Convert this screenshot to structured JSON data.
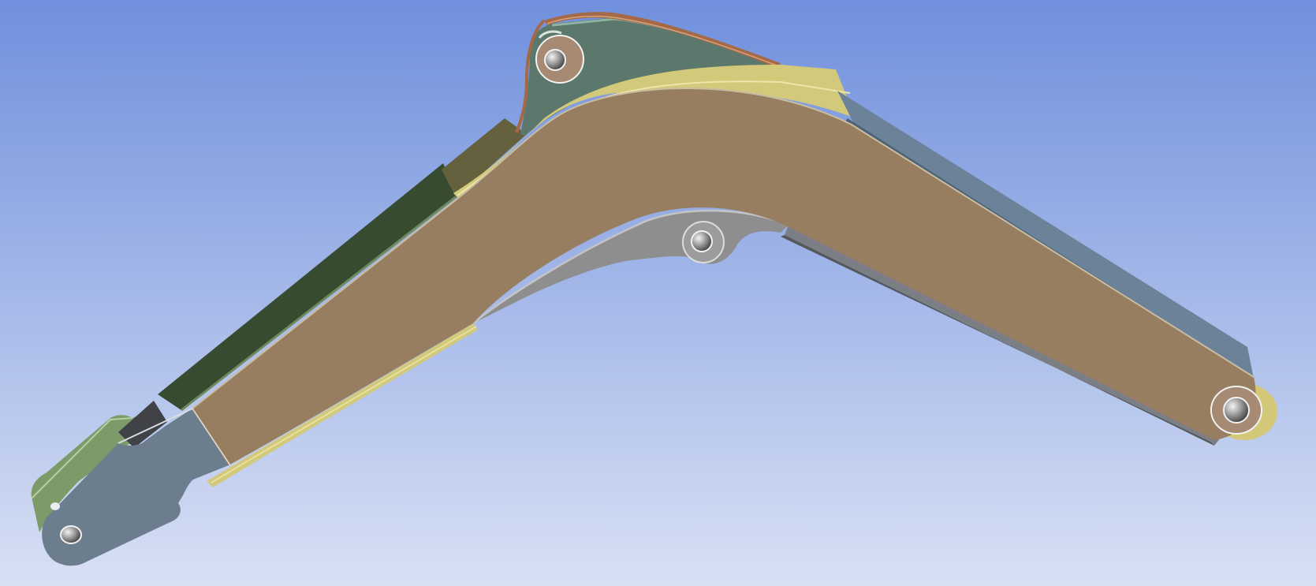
{
  "viewport": {
    "background_top": "#7090dd",
    "background_bottom": "#d8e0f4"
  },
  "model": {
    "colors": {
      "web_plate": "#977e60",
      "web_edge": "#c9bca0",
      "top_flange_front": "#d2ca7a",
      "top_flange_back": "#65603e",
      "flange_edge_light": "#ece6a8",
      "left_upper_plate": "#374b31",
      "left_upper_plate_edge": "#6e8a5c",
      "right_upper_plate": "#6b8299",
      "right_upper_plate_dark": "#4d6277",
      "bottom_plate": "#7a7f86",
      "bottom_plate_dark": "#55585d",
      "gusset_plate": "#5c776c",
      "gusset_edge": "#8fb3a0",
      "top_cap": "#a46a48",
      "top_cap_light": "#d8a27a",
      "lower_bracket": "#8e8e8e",
      "lower_bracket_edge": "#c4c4c4",
      "left_end_plate": "#6c7d8e",
      "left_end_side": "#7d9a69",
      "left_end_dark": "#404247",
      "pin_boss_face": "#a68a73",
      "pin_hole_rim": "#f2f2f2",
      "pin_hole_shadow": "#3a3a3a",
      "right_boss": "#d3c778"
    }
  }
}
